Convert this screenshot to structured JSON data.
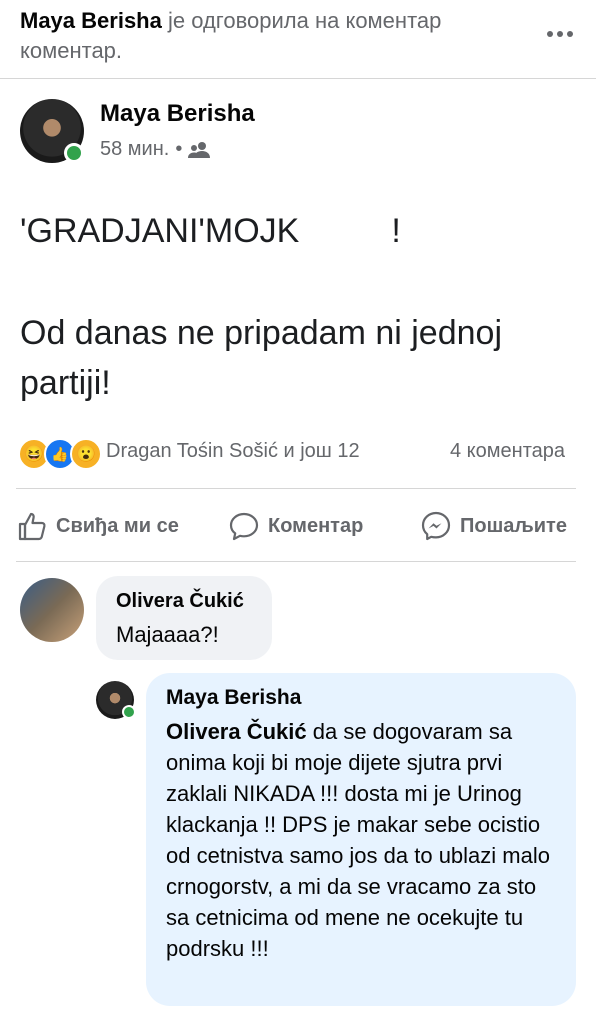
{
  "header": {
    "notice_name": "Maya Berisha",
    "notice_text": " је одговорила на коментар коментар.",
    "more_icon": "more-horizontal-icon"
  },
  "post": {
    "author": "Maya Berisha",
    "time": "58 мин.",
    "dot": "•",
    "audience_icon": "friends-icon",
    "text_line1_prefix": "'GRADJANI'MOJK",
    "text_line1_suffix": "!",
    "text_line2": "Od danas ne pripadam ni jednoj partiji!",
    "reactions": [
      "haha",
      "like",
      "wow"
    ],
    "reactors": "Dragan Tośin Sošić и још 12",
    "comments_count": "4 коментара"
  },
  "actions": {
    "like": "Свиђа ми се",
    "comment": "Коментар",
    "share": "Пошаљите"
  },
  "comment": {
    "author": "Olivera Čukić",
    "text": "Majaaaa?!"
  },
  "reply": {
    "author": "Maya Berisha",
    "mention": "Olivera Čukić",
    "text": " da se dogovaram sa onima koji bi moje dijete sjutra prvi zaklali NIKADA !!! dosta mi je Urinog klackanja !! DPS je makar sebe ocistio od cetnistva samo jos da to ublazi malo crnogorstv, a mi da se vracamo za sto sa cetnicima od mene ne ocekujte tu podrsku !!!"
  },
  "colors": {
    "accent_online": "#31a24c",
    "like_blue": "#1877f2",
    "reply_bubble": "#e7f3ff",
    "comment_bubble": "#f0f2f5"
  }
}
